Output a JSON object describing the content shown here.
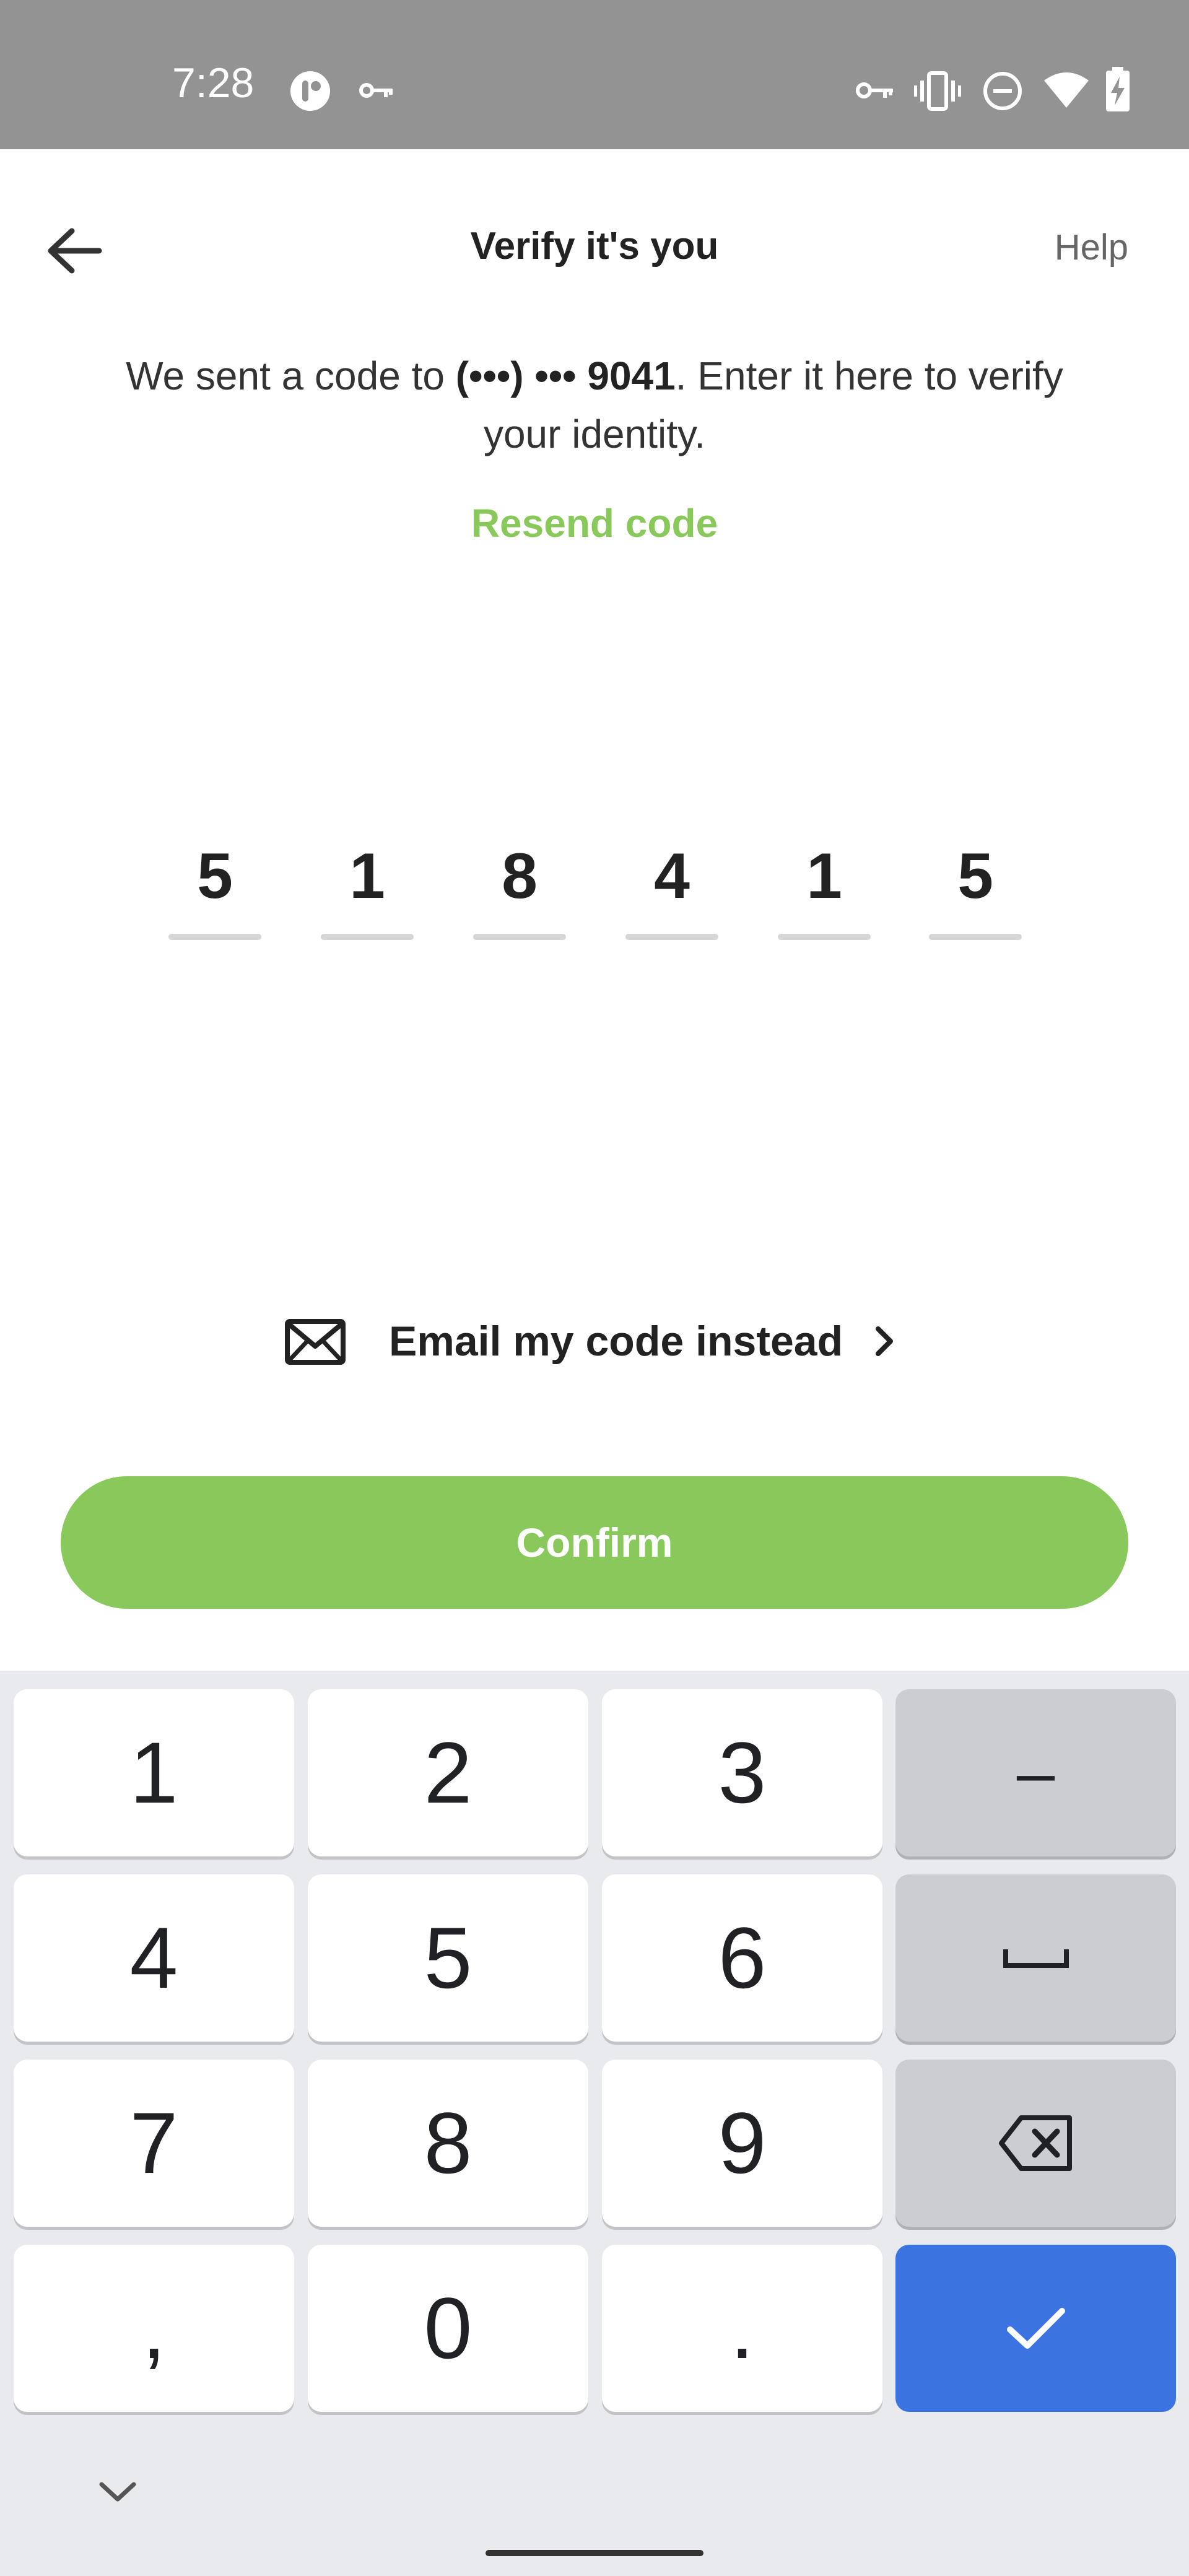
{
  "status_bar": {
    "time": "7:28",
    "left_icons": [
      "app-notification-icon",
      "vpn-key-icon"
    ],
    "right_icons": [
      "vpn-key-icon",
      "vibrate-icon",
      "do-not-disturb-icon",
      "wifi-icon",
      "battery-charging-icon"
    ]
  },
  "header": {
    "title": "Verify it's you",
    "help_label": "Help",
    "back_icon": "arrow-left-icon"
  },
  "description": {
    "prefix": "We sent a code to ",
    "phone": "(•••) ••• 9041",
    "suffix": ". Enter it here to verify your identity."
  },
  "resend_label": "Resend code",
  "code_digits": [
    "5",
    "1",
    "8",
    "4",
    "1",
    "5"
  ],
  "email_instead": {
    "label": "Email my code instead",
    "icon": "envelope-icon",
    "chevron": "chevron-right-icon"
  },
  "confirm_label": "Confirm",
  "keyboard": {
    "rows": [
      [
        "1",
        "2",
        "3",
        "–"
      ],
      [
        "4",
        "5",
        "6",
        "space"
      ],
      [
        "7",
        "8",
        "9",
        "backspace"
      ],
      [
        ",",
        "0",
        ".",
        "done"
      ]
    ],
    "digit_keys": {
      "k1": "1",
      "k2": "2",
      "k3": "3",
      "dash": "–",
      "k4": "4",
      "k5": "5",
      "k6": "6",
      "k7": "7",
      "k8": "8",
      "k9": "9",
      "comma": ",",
      "k0": "0",
      "period": "."
    },
    "collapse_icon": "chevron-down-icon"
  },
  "colors": {
    "accent_green": "#89c95b",
    "status_bar": "#939393",
    "keyboard_bg": "#e9eaed",
    "done_key": "#3b73e0"
  }
}
